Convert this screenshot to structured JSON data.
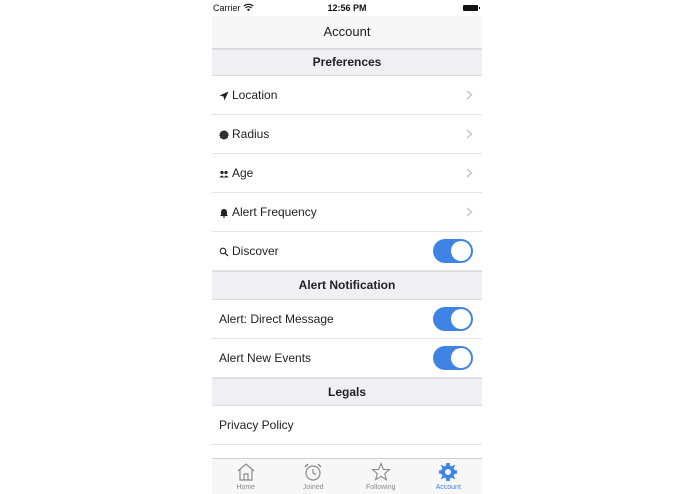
{
  "status_bar": {
    "carrier": "Carrier",
    "time": "12:56 PM"
  },
  "nav": {
    "title": "Account"
  },
  "sections": {
    "preferences": {
      "header": "Preferences",
      "items": [
        {
          "label": "Location",
          "icon": "location-arrow-icon",
          "control": "chevron"
        },
        {
          "label": "Radius",
          "icon": "radius-dot-icon",
          "control": "chevron"
        },
        {
          "label": "Age",
          "icon": "people-icon",
          "control": "chevron"
        },
        {
          "label": "Alert Frequency",
          "icon": "bell-icon",
          "control": "chevron"
        },
        {
          "label": "Discover",
          "icon": "search-icon",
          "control": "toggle",
          "on": true
        }
      ]
    },
    "alert_notification": {
      "header": "Alert Notification",
      "items": [
        {
          "label": "Alert: Direct Message",
          "control": "toggle",
          "on": true
        },
        {
          "label": "Alert New Events",
          "control": "toggle",
          "on": true
        }
      ]
    },
    "legals": {
      "header": "Legals",
      "items": [
        {
          "label": "Privacy Policy"
        }
      ]
    }
  },
  "tab_bar": {
    "tabs": [
      {
        "label": "Home",
        "icon": "home-icon",
        "active": false
      },
      {
        "label": "Joined",
        "icon": "alarm-clock-icon",
        "active": false
      },
      {
        "label": "Following",
        "icon": "star-icon",
        "active": false
      },
      {
        "label": "Account",
        "icon": "gear-icon",
        "active": true
      }
    ]
  },
  "colors": {
    "accent": "#3f84e5",
    "section_bg": "#efeff4",
    "inactive_tab": "#8a8a8a"
  }
}
